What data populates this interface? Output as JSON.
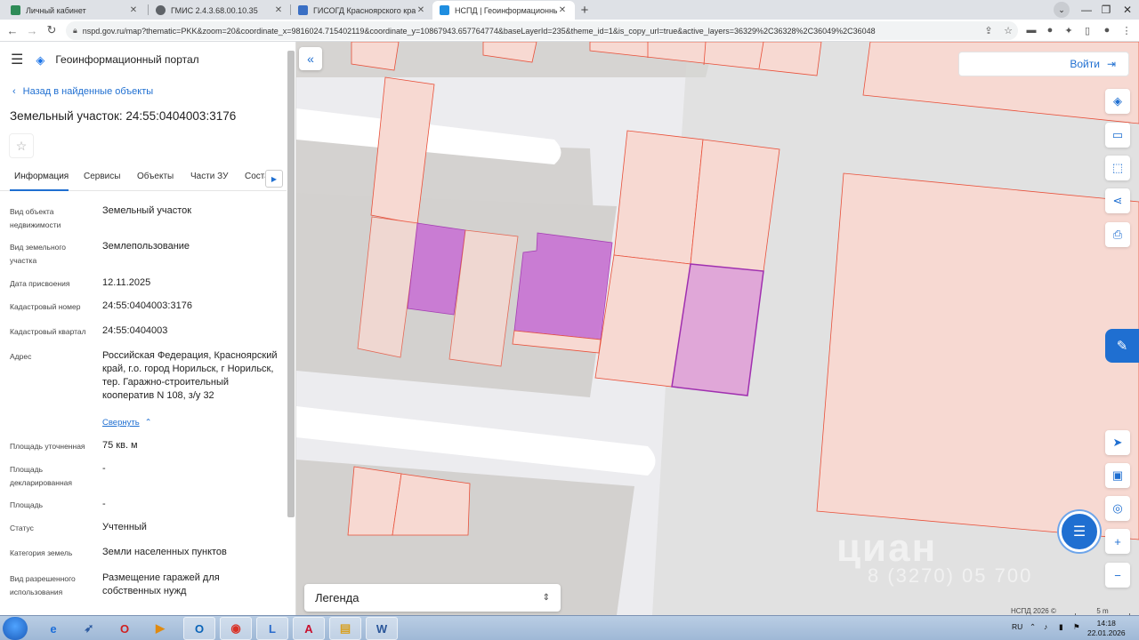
{
  "browser": {
    "tabs": [
      {
        "title": "Личный кабинет",
        "fav_color": "#2e8b57"
      },
      {
        "title": "ГМИС 2.4.3.68.00.10.35",
        "fav_color": "#5f6368"
      },
      {
        "title": "ГИСОГД Красноярского края",
        "fav_color": "#3a6fc4"
      },
      {
        "title": "НСПД | Геоинформационный п",
        "fav_color": "#1f8ee0",
        "active": true
      }
    ],
    "url": "nspd.gov.ru/map?thematic=PKK&zoom=20&coordinate_x=9816024.715402119&coordinate_y=10867943.657764774&baseLayerId=235&theme_id=1&is_copy_url=true&active_layers=36329%2C36328%2C36049%2C36048"
  },
  "portal": {
    "title": "Геоинформационный портал",
    "back_label": "Назад в найденные объекты",
    "parcel_title": "Земельный участок: 24:55:0404003:3176",
    "tabs": [
      "Информация",
      "Сервисы",
      "Объекты",
      "Части ЗУ",
      "Соста"
    ],
    "properties": [
      {
        "label": "Вид объекта недвижимости",
        "value": "Земельный участок"
      },
      {
        "label": "Вид земельного участка",
        "value": "Землепользование"
      },
      {
        "label": "Дата присвоения",
        "value": "12.11.2025"
      },
      {
        "label": "Кадастровый номер",
        "value": "24:55:0404003:3176"
      },
      {
        "label": "Кадастровый квартал",
        "value": "24:55:0404003"
      },
      {
        "label": "Адрес",
        "value": "Российская Федерация, Красноярский край, г.о. город Норильск, г Норильск, тер. Гаражно-строительный кооператив N 108, з/у 32"
      },
      {
        "label": "Площадь уточненная",
        "value": "75 кв. м"
      },
      {
        "label": "Площадь декларированная",
        "value": "-"
      },
      {
        "label": "Площадь",
        "value": "-"
      },
      {
        "label": "Статус",
        "value": "Учтенный"
      },
      {
        "label": "Категория земель",
        "value": "Земли населенных пунктов"
      },
      {
        "label": "Вид разрешенного использования",
        "value": "Размещение гаражей для собственных нужд"
      }
    ],
    "collapse_label": "Свернуть"
  },
  "map": {
    "login_label": "Войти",
    "legend_label": "Легенда",
    "copyright": "НСПД 2026 ©",
    "scale_label": "5 m",
    "watermark": "циан",
    "watermark_phone": "8 (3270) 05 700",
    "colors": {
      "parcel_fill": "#f7d9d2",
      "parcel_stroke": "#e8503a",
      "selected_fill": "#c973d4",
      "selected_stroke": "#a030b0",
      "building": "#d4d2d0"
    }
  },
  "taskbar": {
    "lang": "RU",
    "time": "14:18",
    "date": "22.01.2026"
  }
}
